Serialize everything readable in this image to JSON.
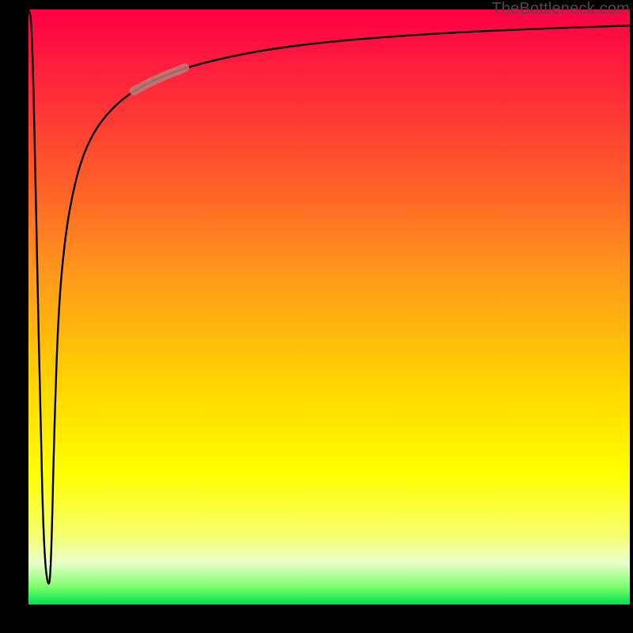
{
  "attribution": "TheBottleneck.com",
  "colors": {
    "frame": "#000000",
    "gradient_top": "#ff0044",
    "gradient_mid1": "#ff9a1a",
    "gradient_mid2": "#ffff00",
    "gradient_bottom": "#00e050",
    "curve": "#000000",
    "highlight": "#b97e77"
  },
  "chart_data": {
    "type": "line",
    "title": "",
    "xlabel": "",
    "ylabel": "",
    "xlim": [
      0,
      100
    ],
    "ylim": [
      0,
      100
    ],
    "grid": false,
    "legend": false,
    "series": [
      {
        "name": "bottleneck-curve",
        "x": [
          0,
          0.6,
          1.4,
          2.0,
          2.6,
          3.4,
          3.8,
          4.3,
          5.0,
          6.1,
          7.5,
          9.2,
          11.5,
          14.5,
          17.5,
          21.0,
          26.0,
          33.0,
          41.0,
          52.0,
          65.0,
          80.0,
          100.0
        ],
        "y": [
          100,
          98,
          60,
          30,
          8,
          2,
          8,
          30,
          50,
          62,
          70,
          76,
          80.5,
          84,
          86.3,
          88.2,
          90.2,
          92.0,
          93.5,
          94.8,
          95.8,
          96.6,
          97.3
        ]
      }
    ],
    "highlight_segment": {
      "x_start": 17.5,
      "x_end": 26.0
    }
  }
}
